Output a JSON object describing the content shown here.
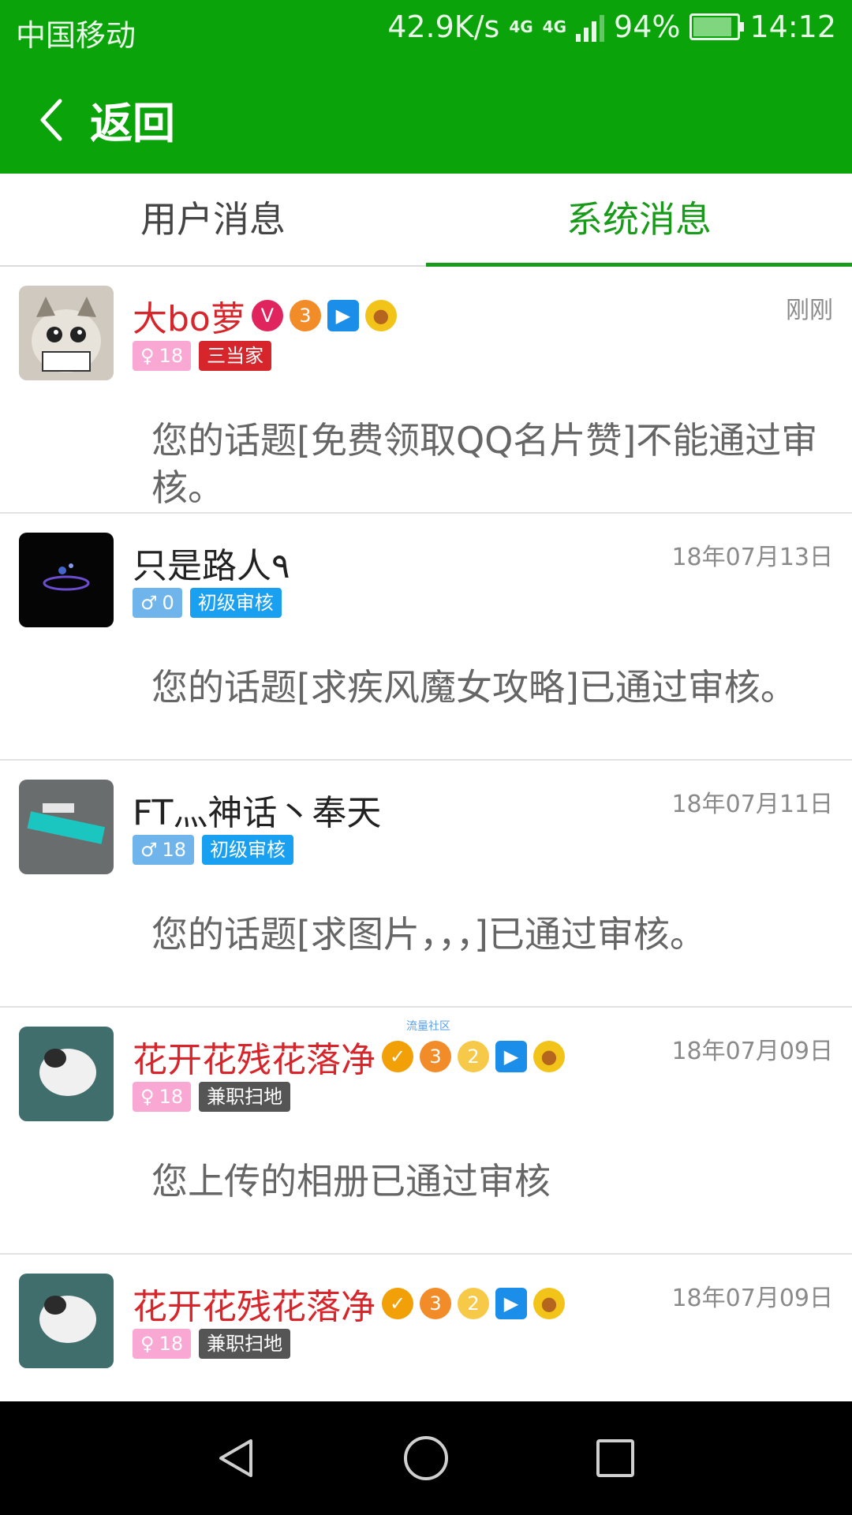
{
  "status": {
    "carrier": "中国移动",
    "speed": "42.9K/s",
    "net1": "4G",
    "net2": "4G",
    "battery": "94%",
    "time": "14:12"
  },
  "header": {
    "back_label": "返回"
  },
  "tabs": [
    {
      "label": "用户消息"
    },
    {
      "label": "系统消息"
    }
  ],
  "messages": [
    {
      "name": "大bo萝",
      "gender": "female",
      "level": "18",
      "title": "三当家",
      "date": "刚刚",
      "text": "您的话题[免费领取QQ名片赞]不能通过审核。"
    },
    {
      "name": "只是路人٩",
      "gender": "male",
      "level": "0",
      "title": "初级审核",
      "date": "18年07月13日",
      "text": "您的话题[求疾风魔女攻略]已通过审核。"
    },
    {
      "name": "FT灬神话丶奉天",
      "gender": "male",
      "level": "18",
      "title": "初级审核",
      "date": "18年07月11日",
      "text": "您的话题[求图片，，，]已通过审核。"
    },
    {
      "name": "花开花残花落净",
      "gender": "female",
      "level": "18",
      "title": "兼职扫地",
      "date": "18年07月09日",
      "text": "您上传的相册已通过审核"
    },
    {
      "name": "花开花残花落净",
      "gender": "female",
      "level": "18",
      "title": "兼职扫地",
      "date": "18年07月09日",
      "text": ""
    }
  ],
  "watermark": "流量社区",
  "colors": {
    "brand_green": "#0aa30a",
    "tab_active": "#1a9a1a",
    "name_red": "#d6262c"
  },
  "icons": {
    "back": "chevron-left-icon",
    "nav": [
      "back-triangle-icon",
      "home-circle-icon",
      "recents-square-icon"
    ]
  }
}
